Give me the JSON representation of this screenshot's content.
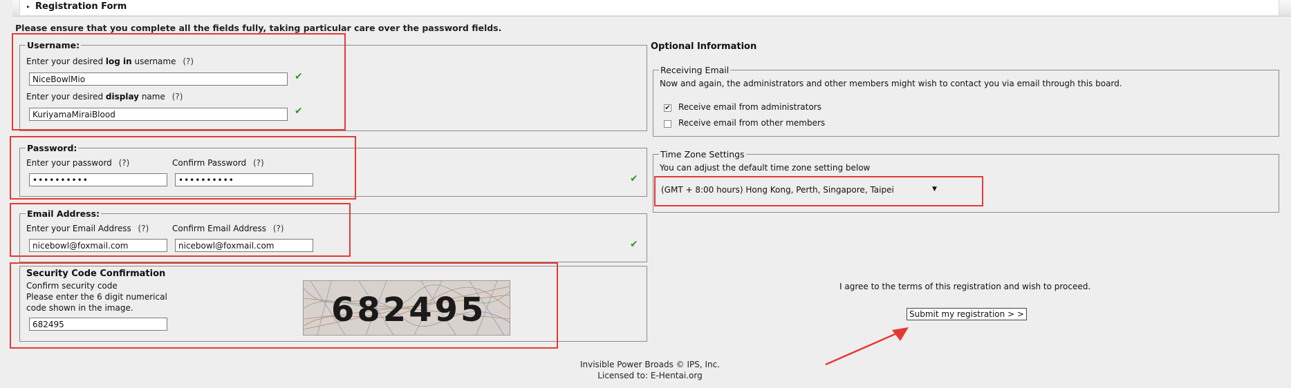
{
  "header": {
    "title": "Registration Form"
  },
  "instructions": "Please ensure that you complete all the fields fully, taking particular care over the password fields.",
  "username": {
    "legend": "Username:",
    "login_label_pre": "Enter your desired ",
    "login_label_bold": "log in",
    "login_label_post": " username",
    "login_value": "NiceBowlMio",
    "display_label_pre": "Enter your desired ",
    "display_label_bold": "display",
    "display_label_post": " name",
    "display_value": "KuriyamaMiraiBlood",
    "help": "(?)"
  },
  "password": {
    "legend": "Password:",
    "enter_label": "Enter your password",
    "confirm_label": "Confirm Password",
    "enter_value": "••••••••••",
    "confirm_value": "••••••••••",
    "help": "(?)"
  },
  "email": {
    "legend": "Email Address:",
    "enter_label": "Enter your Email Address",
    "confirm_label": "Confirm Email Address",
    "enter_value": "nicebowl@foxmail.com",
    "confirm_value": "nicebowl@foxmail.com",
    "help": "(?)"
  },
  "security": {
    "title": "Security Code Confirmation",
    "line1": "Confirm security code",
    "line2": "Please enter the 6 digit numerical",
    "line3": "code shown in the image.",
    "value": "682495",
    "captcha_text": "682495"
  },
  "optional": {
    "title": "Optional Information",
    "receiving_email": {
      "legend": "Receiving Email",
      "desc": "Now and again, the administrators and other members might wish to contact you via email through this board.",
      "opt_admin": "Receive email from administrators",
      "opt_admin_checked": true,
      "opt_members": "Receive email from other members",
      "opt_members_checked": false
    },
    "timezone": {
      "legend": "Time Zone Settings",
      "desc": "You can adjust the default time zone setting below",
      "selected": "(GMT + 8:00 hours) Hong Kong, Perth, Singapore, Taipei"
    }
  },
  "agree": {
    "text": "I agree to the terms of this registration and wish to proceed.",
    "submit_label": "Submit my registration > >"
  },
  "footer": {
    "line1": "Invisible Power Broads © IPS, Inc.",
    "line2": "Licensed to: E-Hentai.org"
  },
  "icons": {
    "valid": "check-icon",
    "dropdown": "triangle-down-icon",
    "collapse": "triangle-right-icon"
  },
  "colors": {
    "highlight": "#e53935",
    "valid": "#2a9a2a",
    "background": "#eeeeee"
  }
}
